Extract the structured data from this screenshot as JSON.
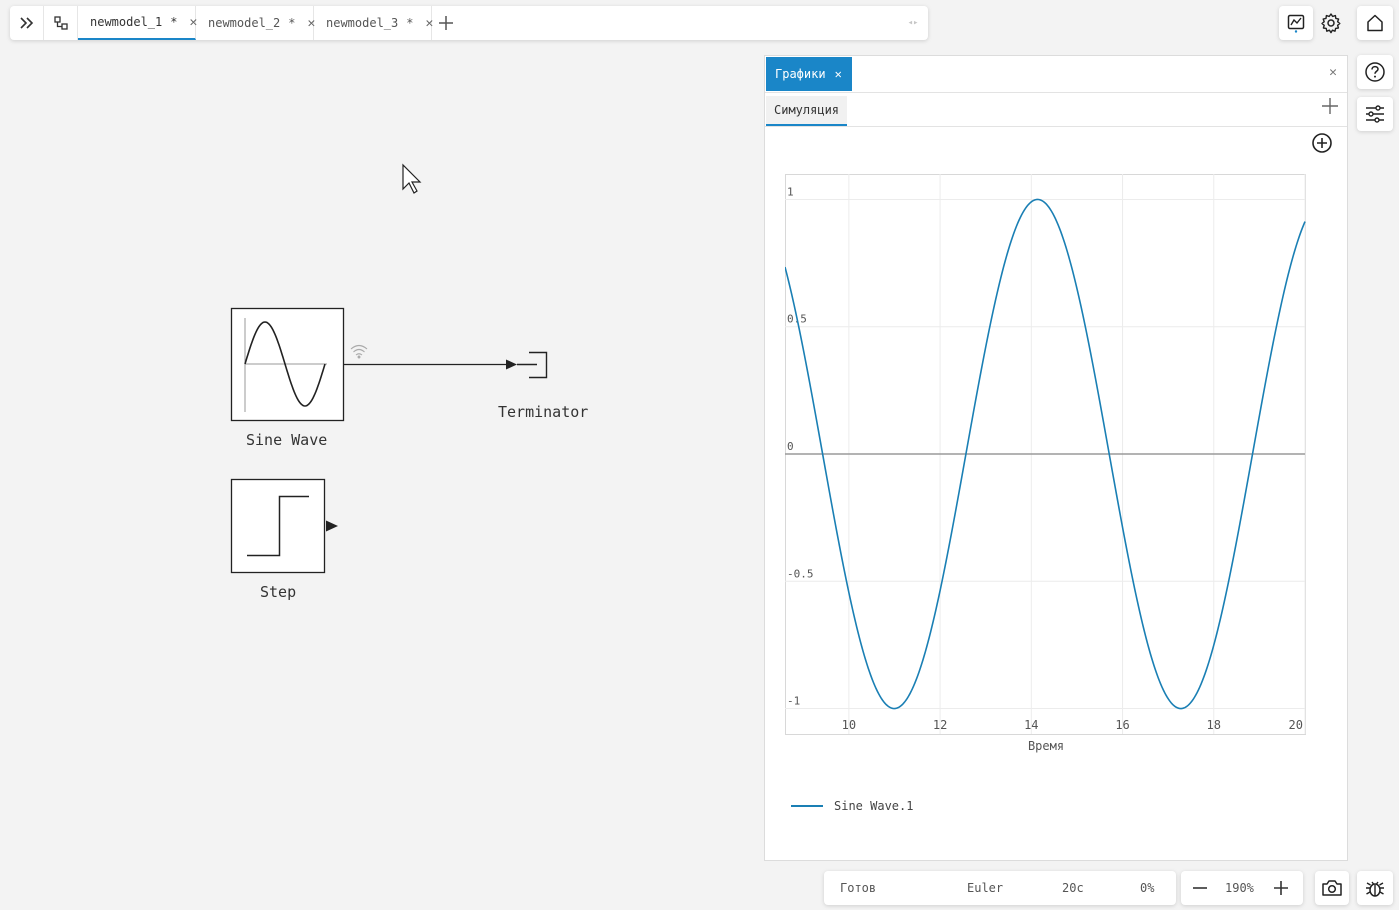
{
  "tabs": [
    {
      "label": "newmodel_1",
      "modified": "*",
      "active": true
    },
    {
      "label": "newmodel_2",
      "modified": "*",
      "active": false
    },
    {
      "label": "newmodel_3",
      "modified": "*",
      "active": false
    }
  ],
  "canvas": {
    "sine_label": "Sine Wave",
    "terminator_label": "Terminator",
    "step_label": "Step"
  },
  "graph_panel": {
    "tab_label": "Графики",
    "subtab_label": "Симуляция",
    "legend_label": "Sine Wave.1"
  },
  "chart_data": {
    "type": "line",
    "xlabel": "Время",
    "ylabel": "",
    "xlim": [
      8.6,
      20
    ],
    "ylim": [
      -1.1,
      1.1
    ],
    "xticks": [
      10,
      12,
      14,
      16,
      18,
      20
    ],
    "yticks": [
      1,
      0.5,
      0,
      -0.5,
      -1
    ],
    "ytick_labels": [
      "1",
      "0.5",
      "0",
      "-0.5",
      "-1"
    ],
    "grid": true,
    "legend_position": "bottom-left",
    "series": [
      {
        "name": "Sine Wave.1",
        "color": "#1a7fb4",
        "function": "sin(t)",
        "t_start": 8.6,
        "t_end": 20
      }
    ]
  },
  "status": {
    "state": "Готов",
    "solver": "Euler",
    "time": "20с",
    "progress": "0%"
  },
  "zoom": {
    "level": "190%"
  },
  "icons": [
    "expand-sidebar-icon",
    "model-tree-icon",
    "plot-window-icon",
    "settings-gear-icon",
    "home-icon",
    "help-icon",
    "filter-settings-icon",
    "camera-icon",
    "debug-icon"
  ]
}
